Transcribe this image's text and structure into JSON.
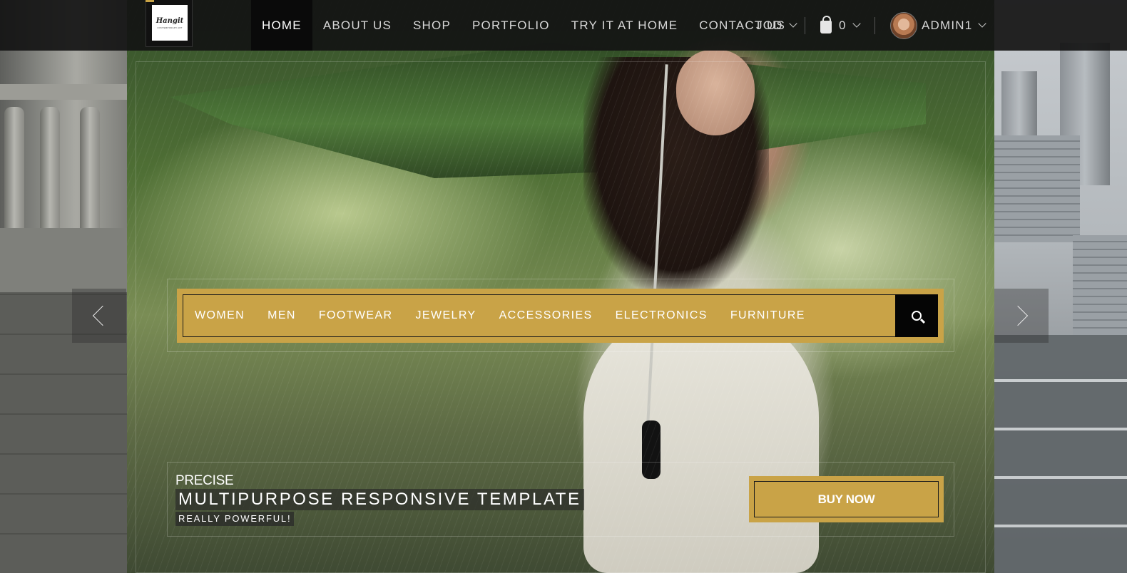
{
  "logo": {
    "brand": "Hangit",
    "tagline": "CONTEMPORARY ART"
  },
  "nav": {
    "items": [
      {
        "label": "HOME",
        "active": true
      },
      {
        "label": "ABOUT US",
        "active": false
      },
      {
        "label": "SHOP",
        "active": false
      },
      {
        "label": "PORTFOLIO",
        "active": false
      },
      {
        "label": "TRY IT AT HOME",
        "active": false
      },
      {
        "label": "CONTACT US",
        "active": false
      }
    ]
  },
  "header": {
    "currency": "JOD",
    "cart_count": "0",
    "user_name": "ADMIN1"
  },
  "categories": {
    "items": [
      "WOMEN",
      "MEN",
      "FOOTWEAR",
      "JEWELRY",
      "ACCESSORIES",
      "ELECTRONICS",
      "FURNITURE"
    ],
    "search_icon": "search-icon"
  },
  "slide": {
    "kicker": "PRECISE",
    "headline": "MULTIPURPOSE RESPONSIVE TEMPLATE",
    "subline": "REALLY POWERFUL!",
    "cta": "BUY NOW"
  },
  "colors": {
    "accent": "#c9a347",
    "header_bg": "#141414",
    "nav_active_bg": "#0a0a0a"
  }
}
